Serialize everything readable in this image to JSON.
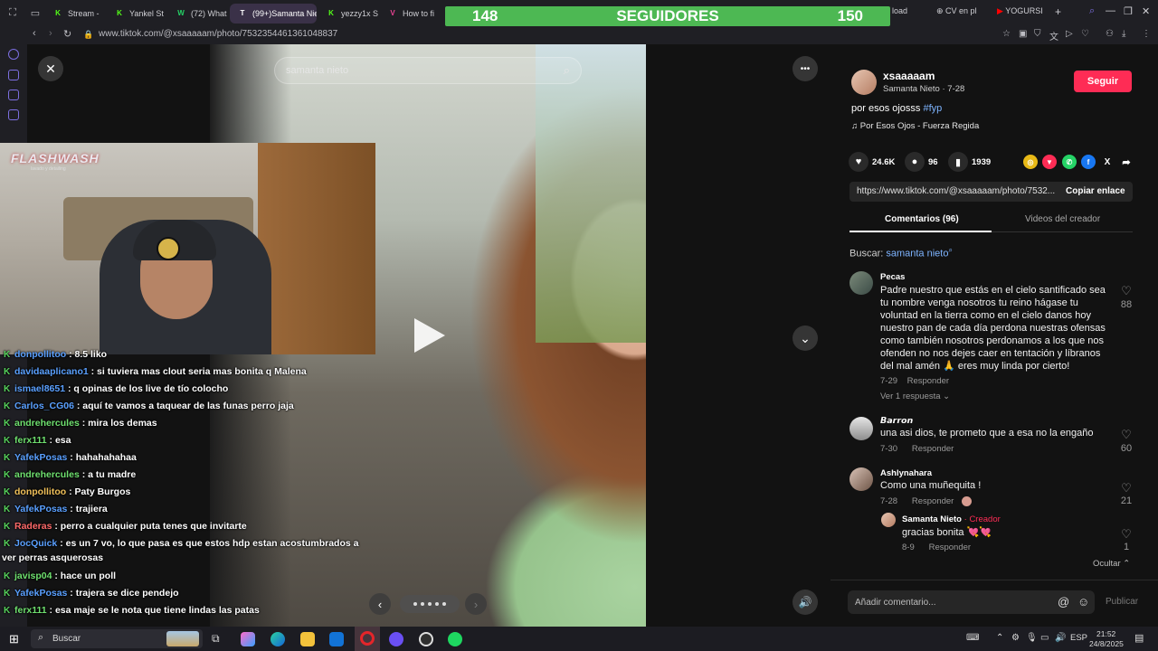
{
  "browser": {
    "tabs": [
      {
        "label": "Stream - ",
        "icon": "K",
        "color": "#53fc18"
      },
      {
        "label": "Yankel St",
        "icon": "K",
        "color": "#53fc18"
      },
      {
        "label": "(72) What",
        "icon": "W",
        "color": "#25d366"
      },
      {
        "label": "(99+)Samanta Nie",
        "icon": "T",
        "color": "#ffffff"
      },
      {
        "label": "yezzy1x S",
        "icon": "K",
        "color": "#53fc18"
      },
      {
        "label": "How to fi",
        "icon": "V",
        "color": "#e84393"
      },
      {
        "label": "load",
        "icon": "",
        "color": ""
      },
      {
        "label": "CV en pl",
        "icon": "C",
        "color": "#bbbbbb"
      },
      {
        "label": "YOGURSI",
        "icon": "Y",
        "color": "#ff0000"
      }
    ],
    "new_tab": "+",
    "url": "www.tiktok.com/@xsaaaaam/photo/7532354461361048837"
  },
  "overlay": {
    "followers_left": "148",
    "followers_title": "SEGUIDORES",
    "followers_right": "150",
    "logo_text": "FLASHWASH",
    "logo_sub": "lavado y detailing"
  },
  "chat": [
    {
      "user": "donpollitoo",
      "msg": ": 8.5 liko",
      "color": "#5aa0ff"
    },
    {
      "user": "davidaaplicano1",
      "msg": ": si tuviera mas clout seria mas bonita q Malena",
      "color": "#5aa0ff"
    },
    {
      "user": "ismael8651",
      "msg": ": q opinas de los live de tío colocho",
      "color": "#5aa0ff"
    },
    {
      "user": "Carlos_CG06",
      "msg": ": aquí te vamos a taquear de las funas perro jaja",
      "color": "#5aa0ff"
    },
    {
      "user": "andrehercules",
      "msg": ": mira los demas",
      "color": "#6fe06f"
    },
    {
      "user": "ferx111",
      "msg": ": esa",
      "color": "#6fe06f"
    },
    {
      "user": "YafekPosas",
      "msg": ": hahahahahaa",
      "color": "#5aa0ff"
    },
    {
      "user": "andrehercules",
      "msg": ": a tu madre",
      "color": "#6fe06f"
    },
    {
      "user": "donpollitoo",
      "msg": ": Paty Burgos",
      "color": "#f0c05a"
    },
    {
      "user": "YafekPosas",
      "msg": ": trajiera",
      "color": "#5aa0ff"
    },
    {
      "user": "Raderas",
      "msg": ": perro a cualquier puta tenes que invitarte",
      "color": "#ff6a6a"
    },
    {
      "user": "JocQuick",
      "msg": ": es un 7 vo, lo que pasa es que estos hdp estan acostumbrados a",
      "color": "#5aa0ff"
    },
    {
      "user": "",
      "msg": "ver perras asquerosas",
      "color": "#5aa0ff"
    },
    {
      "user": "javisp04",
      "msg": ": hace un poll",
      "color": "#6fe06f"
    },
    {
      "user": "YafekPosas",
      "msg": ": trajera se dice pendejo",
      "color": "#5aa0ff"
    },
    {
      "user": "ferx111",
      "msg": ": esa maje se le nota que tiene lindas las patas",
      "color": "#6fe06f"
    }
  ],
  "viewer": {
    "search_value": "samanta nieto",
    "close_icon": "✕",
    "more_icon": "•••"
  },
  "post": {
    "username": "xsaaaaam",
    "display_name": "Samanta Nieto · 7-28",
    "follow_label": "Seguir",
    "caption": "por esos ojosss ",
    "hashtag": "#fyp",
    "music": "Por Esos Ojos - Fuerza Regida",
    "likes": "24.6K",
    "comments": "96",
    "saves": "1939",
    "link": "https://www.tiktok.com/@xsaaaaam/photo/7532...",
    "copy_label": "Copiar enlace",
    "tab_comments": "Comentarios (96)",
    "tab_videos": "Videos del creador",
    "search_prefix": "Buscar: ",
    "search_term": "samanta nieto"
  },
  "comments": [
    {
      "user": "Pecas",
      "lines": [
        "Padre nuestro que estás en el cielo santificado sea",
        "tu nombre venga nosotros tu reino hágase tu",
        "voluntad en la tierra como en el cielo danos hoy",
        "nuestro pan de cada día perdona nuestras ofensas",
        "como también nosotros perdonamos a los que nos",
        "ofenden no nos dejes caer en tentación y líbranos",
        "del mal amén 🙏 eres muy linda por cierto!"
      ],
      "date": "7-29",
      "reply": "Responder",
      "likes": "88",
      "view_replies": "Ver 1 respuesta ⌄"
    },
    {
      "user": "𝘽𝙖𝙧𝙧𝙤𝙣",
      "text": "una asi dios, te prometo que a esa no la engaño",
      "date": "7-30",
      "reply": "Responder",
      "likes": "60"
    },
    {
      "user": "Ashlynahara",
      "text": "Como una muñequita !",
      "date": "7-28",
      "reply": "Responder",
      "likes": "21"
    },
    {
      "user": "Samanta Nieto",
      "creator": " · Creador",
      "text": "gracias bonita 💘💘",
      "date": "8-9",
      "reply": "Responder",
      "likes": "1"
    }
  ],
  "hide_label": "Ocultar ⌃",
  "comment_placeholder": "Añadir comentario...",
  "publish_label": "Publicar",
  "taskbar": {
    "search": "Buscar",
    "lang": "ESP",
    "time": "21:52",
    "date": "24/8/2025"
  }
}
